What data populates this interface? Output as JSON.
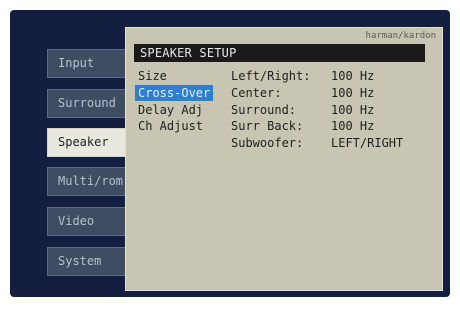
{
  "tabs": [
    {
      "label": "Input"
    },
    {
      "label": "Surround"
    },
    {
      "label": "Speaker"
    },
    {
      "label": "Multi/rom"
    },
    {
      "label": "Video"
    },
    {
      "label": "System"
    }
  ],
  "panel": {
    "brand": "harman/kardon",
    "title": "SPEAKER SETUP",
    "menu": [
      {
        "label": "Size"
      },
      {
        "label": "Cross-Over"
      },
      {
        "label": "Delay Adj"
      },
      {
        "label": "Ch Adjust"
      }
    ],
    "settings": [
      {
        "label": "Left/Right:",
        "value": "100 Hz"
      },
      {
        "label": "Center:",
        "value": "100 Hz"
      },
      {
        "label": "Surround:",
        "value": "100 Hz"
      },
      {
        "label": "Surr Back:",
        "value": "100 Hz"
      },
      {
        "label": "Subwoofer:",
        "value": "LEFT/RIGHT"
      }
    ]
  },
  "colors": {
    "screen_bg": "#131e40",
    "panel_bg": "#c8c6b3",
    "highlight": "#2f7fcf",
    "selected_tab_bg": "#e9e8de"
  }
}
